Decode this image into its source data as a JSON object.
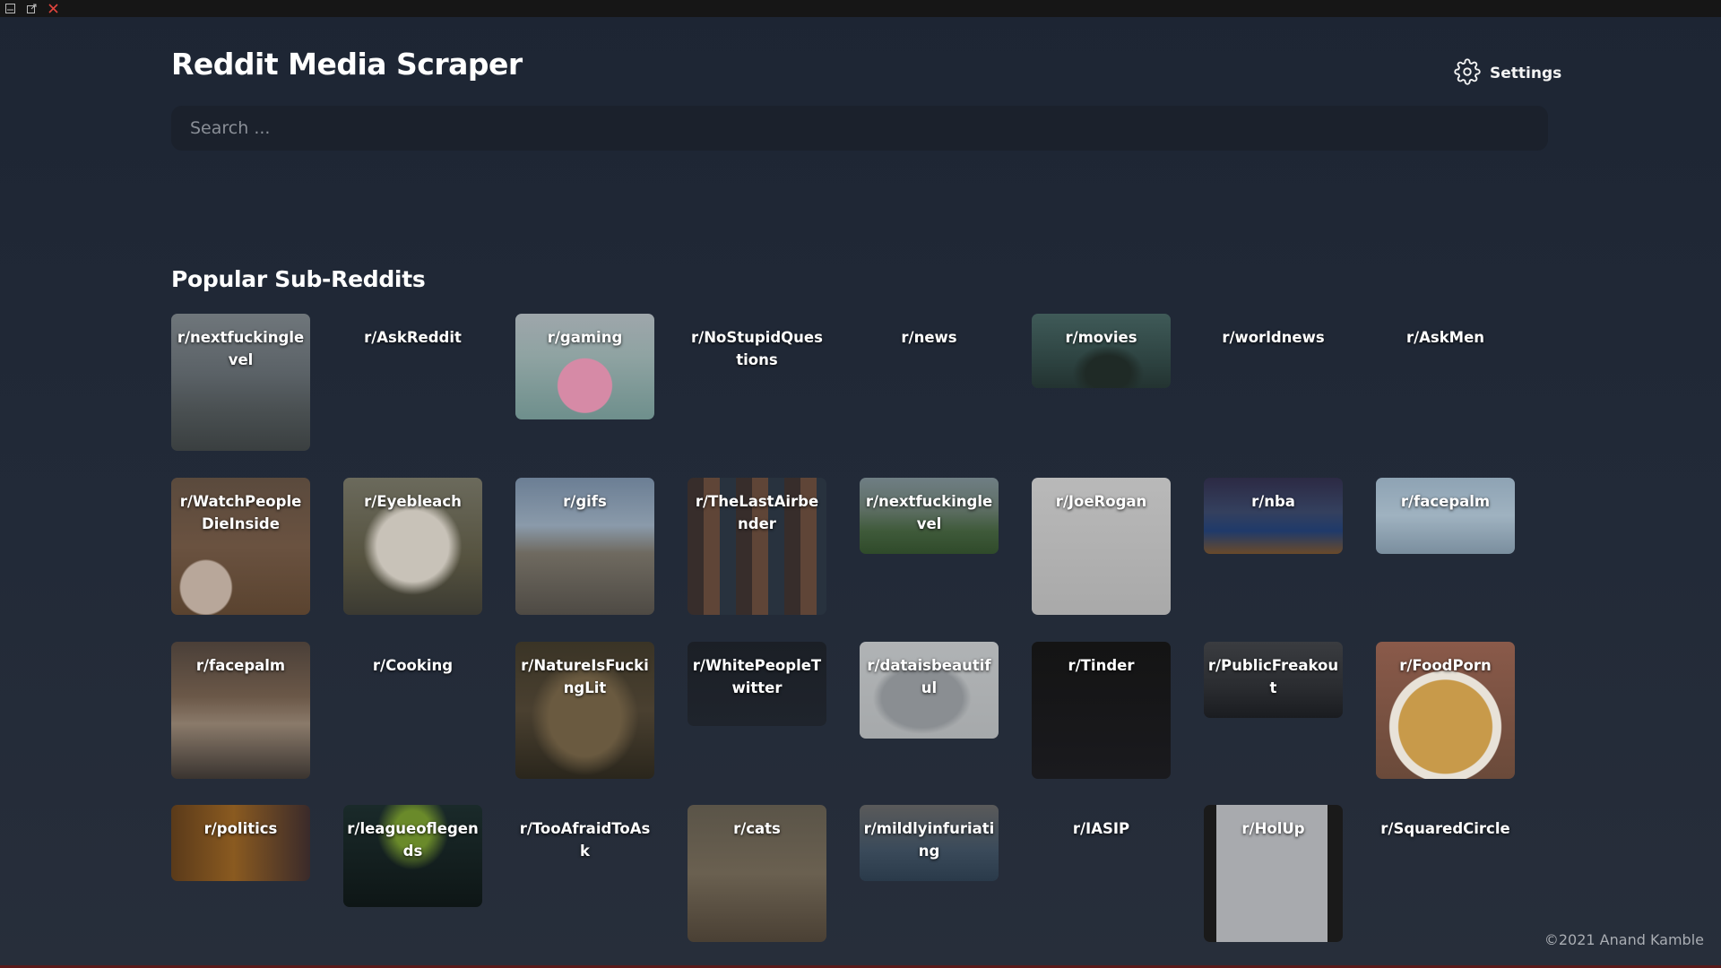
{
  "window": {
    "controls": [
      "minimize-icon",
      "popout-icon",
      "close-icon"
    ]
  },
  "app": {
    "title": "Reddit Media Scraper"
  },
  "settings": {
    "label": "Settings",
    "icon": "gear-icon"
  },
  "search": {
    "placeholder": "Search ..."
  },
  "popular": {
    "title": "Popular Sub-Reddits",
    "subreddits": [
      "r/nextfuckinglevel",
      "r/AskReddit",
      "r/gaming",
      "r/NoStupidQuestions",
      "r/news",
      "r/movies",
      "r/worldnews",
      "r/AskMen",
      "r/WatchPeopleDieInside",
      "r/Eyebleach",
      "r/gifs",
      "r/TheLastAirbender",
      "r/nextfuckinglevel",
      "r/JoeRogan",
      "r/nba",
      "r/facepalm",
      "r/facepalm",
      "r/Cooking",
      "r/NatureIsFuckingLit",
      "r/WhitePeopleTwitter",
      "r/dataisbeautiful",
      "r/Tinder",
      "r/PublicFreakout",
      "r/FoodPorn",
      "r/politics",
      "r/leagueoflegends",
      "r/TooAfraidToAsk",
      "r/cats",
      "r/mildlyinfuriating",
      "r/IASIP",
      "r/HolUp",
      "r/SquaredCircle"
    ]
  },
  "footer": {
    "copyright": "©2021 Anand Kamble"
  }
}
